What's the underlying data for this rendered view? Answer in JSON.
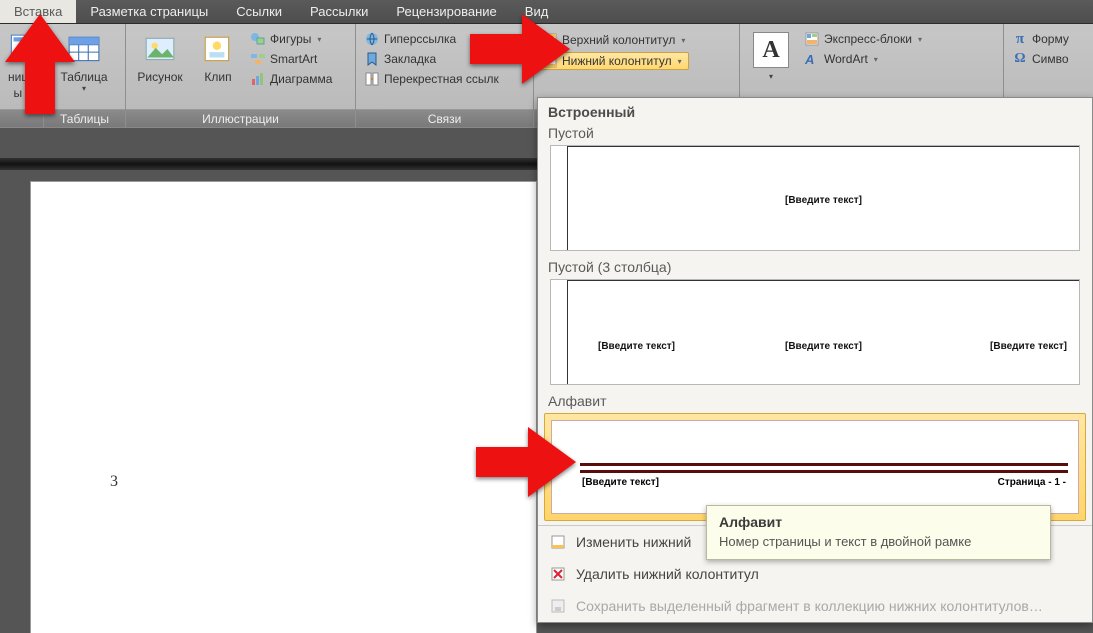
{
  "tabs": [
    "Вставка",
    "Разметка страницы",
    "Ссылки",
    "Рассылки",
    "Рецензирование",
    "Вид"
  ],
  "active_tab_index": 0,
  "ribbon": {
    "pages": {
      "label": "",
      "item_suffix": "ница",
      "item2_suffix": "ы"
    },
    "tables": {
      "group_label": "Таблицы",
      "table": "Таблица"
    },
    "illus": {
      "group_label": "Иллюстрации",
      "pic": "Рисунок",
      "clip": "Клип",
      "shapes": "Фигуры",
      "smartart": "SmartArt",
      "chart": "Диаграмма"
    },
    "links": {
      "group_label": "Связи",
      "hyper": "Гиперссылка",
      "bookmark": "Закладка",
      "xref": "Перекрестная ссылк"
    },
    "hf": {
      "header": "Верхний колонтитул",
      "footer": "Нижний колонтитул"
    },
    "text": {
      "letter_icon": "A",
      "quickparts": "Экспресс-блоки",
      "wordart": "WordArt"
    },
    "sym": {
      "formula": "Форму",
      "symbol": "Симво"
    }
  },
  "page": {
    "num": "3"
  },
  "gallery": {
    "heading": "Встроенный",
    "cat_empty": "Пустой",
    "cat_empty3": "Пустой (3 столбца)",
    "cat_alpha": "Алфавит",
    "placeholder": "[Введите текст]",
    "page_label": "Страница - 1 -",
    "tt_title": "Алфавит",
    "tt_body": "Номер страницы и текст в двойной рамке",
    "edit": "Изменить нижний",
    "delete": "Удалить нижний колонтитул",
    "save": "Сохранить выделенный фрагмент в коллекцию нижних колонтитулов…"
  }
}
